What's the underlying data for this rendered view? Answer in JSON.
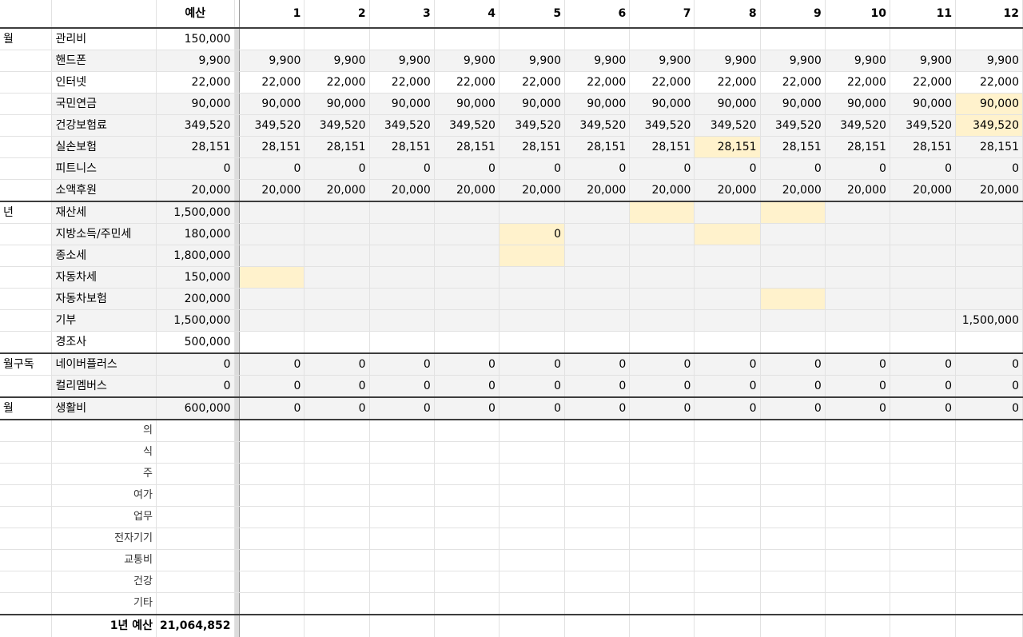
{
  "header": {
    "budget_label": "예산",
    "months": [
      "1",
      "2",
      "3",
      "4",
      "5",
      "6",
      "7",
      "8",
      "9",
      "10",
      "11",
      "12"
    ]
  },
  "colors": {
    "cell_fill": "#f3f3f3",
    "highlight": "#fff2cc"
  },
  "groups": [
    {
      "category": "월",
      "rows": [
        {
          "item": "관리비",
          "budget": "150,000",
          "cells": [
            "",
            "",
            "",
            "",
            "",
            "",
            "",
            "",
            "",
            "",
            "",
            ""
          ],
          "fill": "white"
        },
        {
          "item": "핸드폰",
          "budget": "9,900",
          "cells": [
            "9,900",
            "9,900",
            "9,900",
            "9,900",
            "9,900",
            "9,900",
            "9,900",
            "9,900",
            "9,900",
            "9,900",
            "9,900",
            "9,900"
          ]
        },
        {
          "item": "인터넷",
          "budget": "22,000",
          "cells": [
            "22,000",
            "22,000",
            "22,000",
            "22,000",
            "22,000",
            "22,000",
            "22,000",
            "22,000",
            "22,000",
            "22,000",
            "22,000",
            "22,000"
          ],
          "fill": "white"
        },
        {
          "item": "국민연금",
          "budget": "90,000",
          "cells": [
            "90,000",
            "90,000",
            "90,000",
            "90,000",
            "90,000",
            "90,000",
            "90,000",
            "90,000",
            "90,000",
            "90,000",
            "90,000",
            "90,000"
          ],
          "highlight": [
            12
          ]
        },
        {
          "item": "건강보험료",
          "budget": "349,520",
          "cells": [
            "349,520",
            "349,520",
            "349,520",
            "349,520",
            "349,520",
            "349,520",
            "349,520",
            "349,520",
            "349,520",
            "349,520",
            "349,520",
            "349,520"
          ],
          "highlight": [
            12
          ]
        },
        {
          "item": "실손보험",
          "budget": "28,151",
          "cells": [
            "28,151",
            "28,151",
            "28,151",
            "28,151",
            "28,151",
            "28,151",
            "28,151",
            "28,151",
            "28,151",
            "28,151",
            "28,151",
            "28,151"
          ],
          "highlight": [
            8
          ]
        },
        {
          "item": "피트니스",
          "budget": "0",
          "cells": [
            "0",
            "0",
            "0",
            "0",
            "0",
            "0",
            "0",
            "0",
            "0",
            "0",
            "0",
            "0"
          ]
        },
        {
          "item": "소액후원",
          "budget": "20,000",
          "cells": [
            "20,000",
            "20,000",
            "20,000",
            "20,000",
            "20,000",
            "20,000",
            "20,000",
            "20,000",
            "20,000",
            "20,000",
            "20,000",
            "20,000"
          ]
        }
      ]
    },
    {
      "category": "년",
      "rows": [
        {
          "item": "재산세",
          "budget": "1,500,000",
          "cells": [
            "",
            "",
            "",
            "",
            "",
            "",
            "",
            "",
            "",
            "",
            "",
            ""
          ],
          "highlight": [
            7,
            9
          ]
        },
        {
          "item": "지방소득/주민세",
          "budget": "180,000",
          "cells": [
            "",
            "",
            "",
            "",
            "0",
            "",
            "",
            "",
            "",
            "",
            "",
            ""
          ],
          "highlight": [
            5,
            8
          ]
        },
        {
          "item": "종소세",
          "budget": "1,800,000",
          "cells": [
            "",
            "",
            "",
            "",
            "",
            "",
            "",
            "",
            "",
            "",
            "",
            ""
          ],
          "highlight": [
            5
          ]
        },
        {
          "item": "자동차세",
          "budget": "150,000",
          "cells": [
            "",
            "",
            "",
            "",
            "",
            "",
            "",
            "",
            "",
            "",
            "",
            ""
          ],
          "highlight": [
            1
          ]
        },
        {
          "item": "자동차보험",
          "budget": "200,000",
          "cells": [
            "",
            "",
            "",
            "",
            "",
            "",
            "",
            "",
            "",
            "",
            "",
            ""
          ],
          "highlight": [
            9
          ]
        },
        {
          "item": "기부",
          "budget": "1,500,000",
          "cells": [
            "",
            "",
            "",
            "",
            "",
            "",
            "",
            "",
            "",
            "",
            "",
            "1,500,000"
          ]
        },
        {
          "item": "경조사",
          "budget": "500,000",
          "cells": [
            "",
            "",
            "",
            "",
            "",
            "",
            "",
            "",
            "",
            "",
            "",
            ""
          ],
          "fill": "white"
        }
      ]
    },
    {
      "category": "월구독",
      "rows": [
        {
          "item": "네이버플러스",
          "budget": "0",
          "cells": [
            "0",
            "0",
            "0",
            "0",
            "0",
            "0",
            "0",
            "0",
            "0",
            "0",
            "0",
            "0"
          ]
        },
        {
          "item": "컬리멤버스",
          "budget": "0",
          "cells": [
            "0",
            "0",
            "0",
            "0",
            "0",
            "0",
            "0",
            "0",
            "0",
            "0",
            "0",
            "0"
          ]
        }
      ]
    },
    {
      "category": "월",
      "rows": [
        {
          "item": "생활비",
          "budget": "600,000",
          "cells": [
            "0",
            "0",
            "0",
            "0",
            "0",
            "0",
            "0",
            "0",
            "0",
            "0",
            "0",
            "0"
          ]
        }
      ]
    }
  ],
  "subcategories": [
    "의",
    "식",
    "주",
    "여가",
    "업무",
    "전자기기",
    "교통비",
    "건강",
    "기타"
  ],
  "total": {
    "label": "1년 예산",
    "value": "21,064,852"
  }
}
